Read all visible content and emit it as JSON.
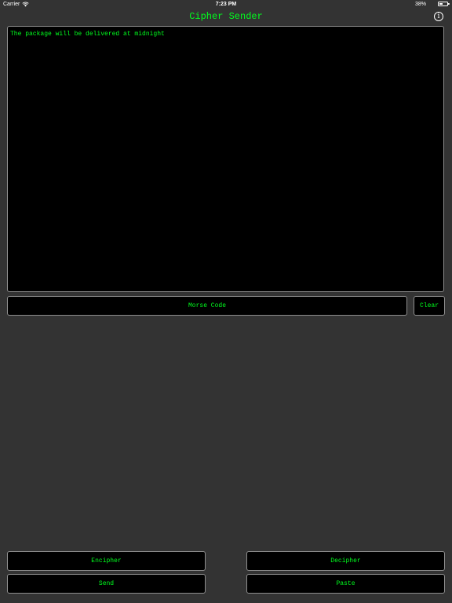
{
  "status_bar": {
    "carrier": "Carrier",
    "time": "7:23 PM",
    "battery": "38%"
  },
  "header": {
    "title": "Cipher Sender"
  },
  "message": {
    "text": "The package will be delivered at midnight"
  },
  "cipher_selector": {
    "label": "Morse Code"
  },
  "buttons": {
    "clear": "Clear",
    "encipher": "Encipher",
    "decipher": "Decipher",
    "send": "Send",
    "paste": "Paste"
  },
  "colors": {
    "accent": "#00ff1e",
    "background": "#333333",
    "field": "#000000",
    "border": "#8e8e8e"
  },
  "icons": {
    "info": "info-icon",
    "wifi": "wifi-icon",
    "battery": "battery-icon"
  },
  "battery_level": 0.38
}
